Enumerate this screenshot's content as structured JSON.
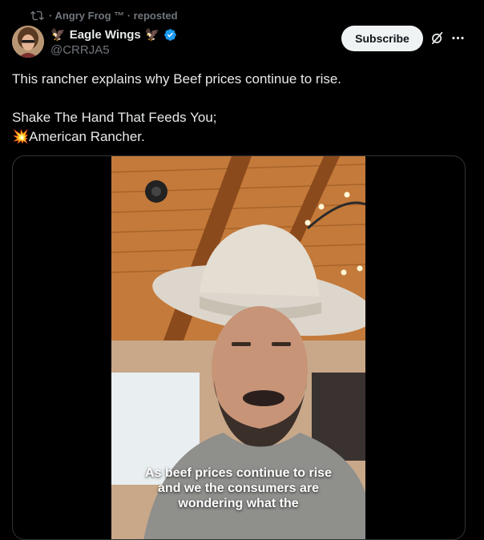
{
  "repost": {
    "label": "· Angry Frog ™ · reposted",
    "icon": "repost-icon"
  },
  "author": {
    "display_name": "Eagle Wings",
    "name_emoji_left": "🦅",
    "name_emoji_right": "🦅",
    "handle": "@CRRJA5",
    "verified": true,
    "avatar_icon": "avatar"
  },
  "actions": {
    "subscribe_label": "Subscribe",
    "grok_icon": "grok-icon",
    "more_icon": "more-icon"
  },
  "tweet": {
    "line1": "This rancher explains why Beef prices continue to rise.",
    "line2": "Shake The Hand That Feeds You;",
    "line3_emoji": "💥",
    "line3": "American Rancher."
  },
  "video": {
    "caption": "As beef prices continue to rise and we the consumers are wondering what the"
  },
  "colors": {
    "background": "#000000",
    "text": "#e7e9ea",
    "secondary": "#71767b",
    "verified": "#1d9bf0",
    "subscribe_bg": "#eff3f4",
    "border": "#2f3336"
  }
}
